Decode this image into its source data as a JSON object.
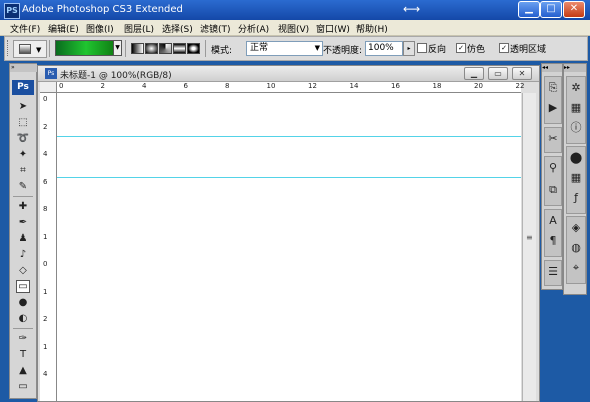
{
  "window": {
    "title": "Adobe Photoshop CS3 Extended",
    "app_icon": "PS",
    "minimize": "▁",
    "maximize": "□",
    "close": "✕",
    "cursor_glyph": "⟷"
  },
  "menu": [
    "文件(F)",
    "编辑(E)",
    "图像(I)",
    "图层(L)",
    "选择(S)",
    "滤镜(T)",
    "分析(A)",
    "视图(V)",
    "窗口(W)",
    "帮助(H)"
  ],
  "options": {
    "mode_label": "模式:",
    "mode_value": "正常",
    "opacity_label": "不透明度:",
    "opacity_value": "100%",
    "reverse_label": "反向",
    "reverse_checked": false,
    "dither_label": "仿色",
    "dither_checked": true,
    "transparency_label": "透明区域",
    "transparency_checked": true
  },
  "toolbox": {
    "logo": "Ps",
    "tools": [
      "move",
      "marquee",
      "lasso",
      "magic-wand",
      "crop",
      "eyedropper",
      "healing-brush",
      "brush",
      "clone-stamp",
      "history-brush",
      "eraser",
      "gradient",
      "blur",
      "dodge",
      "pen",
      "type",
      "path-selection",
      "rectangle"
    ]
  },
  "document": {
    "title": "未标题-1 @ 100%(RGB/8)",
    "ruler_top": [
      "0",
      "2",
      "4",
      "6",
      "8",
      "10",
      "12",
      "14",
      "16",
      "18",
      "20",
      "22"
    ],
    "ruler_left": [
      "0",
      "2",
      "4",
      "6",
      "8",
      "1",
      "0",
      "1",
      "2",
      "1",
      "4"
    ],
    "guides_count": 2
  },
  "colors": {
    "titlebar": "#1f5bc0",
    "menubar": "#ece9d8",
    "guide": "#53d3e8",
    "gradient_swatch": "#20c530"
  }
}
